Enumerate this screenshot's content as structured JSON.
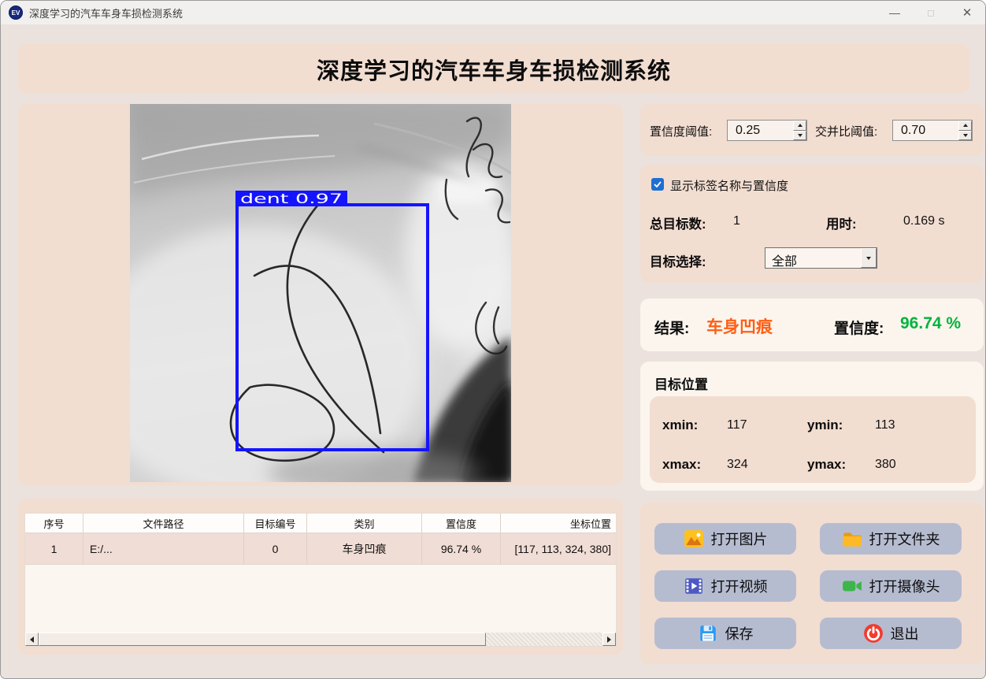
{
  "window": {
    "title": "深度学习的汽车车身车损检测系统",
    "icon_text": "EV",
    "controls": {
      "minimize": "—",
      "maximize": "◻",
      "close": "✕"
    }
  },
  "header": {
    "title": "深度学习的汽车车身车损检测系统"
  },
  "viewer": {
    "detection_label": "dent 0.97"
  },
  "controls": {
    "conf_label": "置信度阈值:",
    "conf_value": "0.25",
    "iou_label": "交并比阈值:",
    "iou_value": "0.70",
    "show_labels_checkbox": "显示标签名称与置信度",
    "total_label": "总目标数:",
    "total_value": "1",
    "time_label": "用时:",
    "time_value": "0.169 s",
    "target_select_label": "目标选择:",
    "target_select_value": "全部"
  },
  "result": {
    "result_label": "结果:",
    "result_value": "车身凹痕",
    "conf_label": "置信度:",
    "conf_value": "96.74 %"
  },
  "position": {
    "title": "目标位置",
    "xmin_label": "xmin:",
    "xmin_value": "117",
    "ymin_label": "ymin:",
    "ymin_value": "113",
    "xmax_label": "xmax:",
    "xmax_value": "324",
    "ymax_label": "ymax:",
    "ymax_value": "380"
  },
  "table": {
    "headers": [
      "序号",
      "文件路径",
      "目标编号",
      "类别",
      "置信度",
      "坐标位置"
    ],
    "rows": [
      [
        "1",
        "E:/...",
        "0",
        "车身凹痕",
        "96.74 %",
        "[117, 113, 324, 380]"
      ]
    ]
  },
  "buttons": [
    {
      "label": "打开图片",
      "icon": "image-icon"
    },
    {
      "label": "打开文件夹",
      "icon": "folder-icon"
    },
    {
      "label": "打开视频",
      "icon": "video-icon"
    },
    {
      "label": "打开摄像头",
      "icon": "camera-icon"
    },
    {
      "label": "保存",
      "icon": "save-icon"
    },
    {
      "label": "退出",
      "icon": "exit-icon"
    }
  ],
  "colors": {
    "panel_peach": "#f2ddd1",
    "panel_cream": "#fbf5ee",
    "window_bg": "#ebe2dd",
    "button_bg": "#b6bcd0",
    "result_orange": "#ff5e14",
    "confidence_green": "#00b43c",
    "detection_blue": "#1414ff",
    "checkbox_blue": "#1e6fd2"
  }
}
